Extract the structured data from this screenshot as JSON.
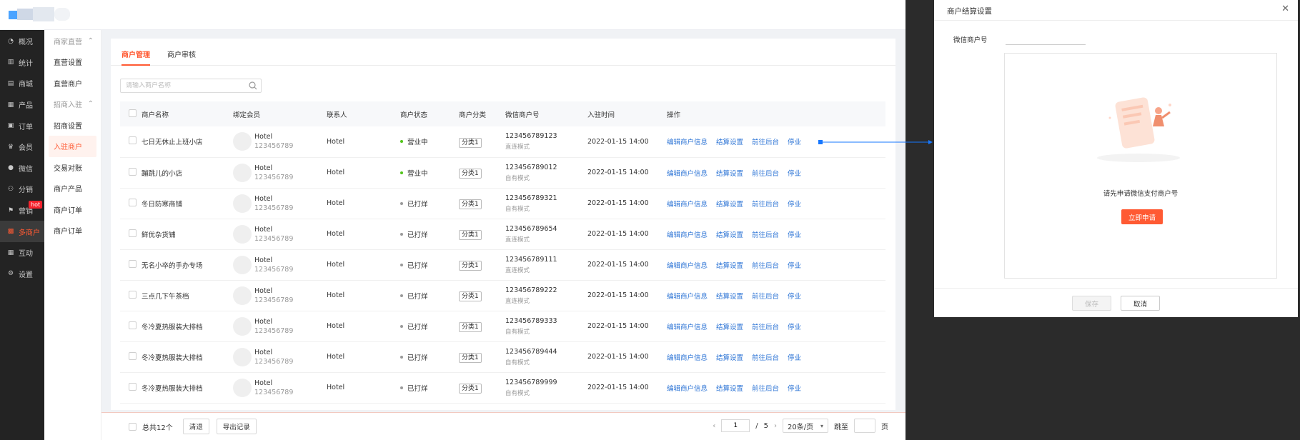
{
  "colors": {
    "accent": "#ff5a33",
    "link": "#2f76d6",
    "open": "#52c41a",
    "closed": "#999999"
  },
  "nav": [
    {
      "label": "概况",
      "icon": "dashboard-icon"
    },
    {
      "label": "统计",
      "icon": "chart-icon"
    },
    {
      "label": "商城",
      "icon": "shop-icon"
    },
    {
      "label": "产品",
      "icon": "grid-icon"
    },
    {
      "label": "订单",
      "icon": "order-icon"
    },
    {
      "label": "会员",
      "icon": "member-icon"
    },
    {
      "label": "微信",
      "icon": "wechat-icon"
    },
    {
      "label": "分销",
      "icon": "distribution-icon"
    },
    {
      "label": "营销",
      "icon": "flag-icon",
      "badge": "hot"
    },
    {
      "label": "多商户",
      "icon": "merchants-icon",
      "active": true
    },
    {
      "label": "互动",
      "icon": "interact-icon"
    },
    {
      "label": "设置",
      "icon": "settings-icon"
    }
  ],
  "subnav": {
    "group1": "商家直营",
    "group1_items": [
      "直营设置",
      "直营商户"
    ],
    "group2": "招商入驻",
    "group2_items": [
      "招商设置",
      "入驻商户",
      "交易对账",
      "商户产品",
      "商户订单",
      "商户订单"
    ]
  },
  "tabs": [
    "商户管理",
    "商户审核"
  ],
  "search": {
    "placeholder": "请输入商户名称"
  },
  "table": {
    "headers": [
      "商户名称",
      "绑定会员",
      "联系人",
      "商户状态",
      "商户分类",
      "微信商户号",
      "入驻时间",
      "操作"
    ],
    "ops": [
      "编辑商户信息",
      "结算设置",
      "前往后台",
      "停业"
    ],
    "rows": [
      {
        "name": "七日无休止上班小店",
        "member": "Hotel",
        "member_id": "123456789",
        "contact": "Hotel",
        "status": "营业中",
        "open": true,
        "category": "分类1",
        "wx": "123456789123",
        "wx_mode": "直连模式",
        "time": "2022-01-15  14:00"
      },
      {
        "name": "蹦跳儿的小店",
        "member": "Hotel",
        "member_id": "123456789",
        "contact": "Hotel",
        "status": "营业中",
        "open": true,
        "category": "分类1",
        "wx": "123456789012",
        "wx_mode": "自有模式",
        "time": "2022-01-15  14:00"
      },
      {
        "name": "冬日防寒商铺",
        "member": "Hotel",
        "member_id": "123456789",
        "contact": "Hotel",
        "status": "已打烊",
        "open": false,
        "category": "分类1",
        "wx": "123456789321",
        "wx_mode": "自有模式",
        "time": "2022-01-15  14:00"
      },
      {
        "name": "鲜优杂货铺",
        "member": "Hotel",
        "member_id": "123456789",
        "contact": "Hotel",
        "status": "已打烊",
        "open": false,
        "category": "分类1",
        "wx": "123456789654",
        "wx_mode": "直连模式",
        "time": "2022-01-15  14:00"
      },
      {
        "name": "无名小卒的手办专场",
        "member": "Hotel",
        "member_id": "123456789",
        "contact": "Hotel",
        "status": "已打烊",
        "open": false,
        "category": "分类1",
        "wx": "123456789111",
        "wx_mode": "直连模式",
        "time": "2022-01-15  14:00"
      },
      {
        "name": "三点几下午茶档",
        "member": "Hotel",
        "member_id": "123456789",
        "contact": "Hotel",
        "status": "已打烊",
        "open": false,
        "category": "分类1",
        "wx": "123456789222",
        "wx_mode": "直连模式",
        "time": "2022-01-15  14:00"
      },
      {
        "name": "冬冷夏热服装大排档",
        "member": "Hotel",
        "member_id": "123456789",
        "contact": "Hotel",
        "status": "已打烊",
        "open": false,
        "category": "分类1",
        "wx": "123456789333",
        "wx_mode": "自有模式",
        "time": "2022-01-15  14:00"
      },
      {
        "name": "冬冷夏热服装大排档",
        "member": "Hotel",
        "member_id": "123456789",
        "contact": "Hotel",
        "status": "已打烊",
        "open": false,
        "category": "分类1",
        "wx": "123456789444",
        "wx_mode": "自有模式",
        "time": "2022-01-15  14:00"
      },
      {
        "name": "冬冷夏热服装大排档",
        "member": "Hotel",
        "member_id": "123456789",
        "contact": "Hotel",
        "status": "已打烊",
        "open": false,
        "category": "分类1",
        "wx": "123456789999",
        "wx_mode": "自有模式",
        "time": "2022-01-15  14:00"
      }
    ]
  },
  "footer": {
    "total": "总共12个",
    "clear": "清退",
    "export": "导出记录",
    "page": "1",
    "sep": "/",
    "pages": "5",
    "per_page": "20条/页",
    "jump_label": "跳至",
    "page_unit": "页"
  },
  "modal": {
    "title": "商户结算设置",
    "field_label": "微信商户号",
    "empty_message": "请先申请微信支付商户号",
    "apply": "立即申请",
    "save": "保存",
    "cancel": "取消"
  }
}
